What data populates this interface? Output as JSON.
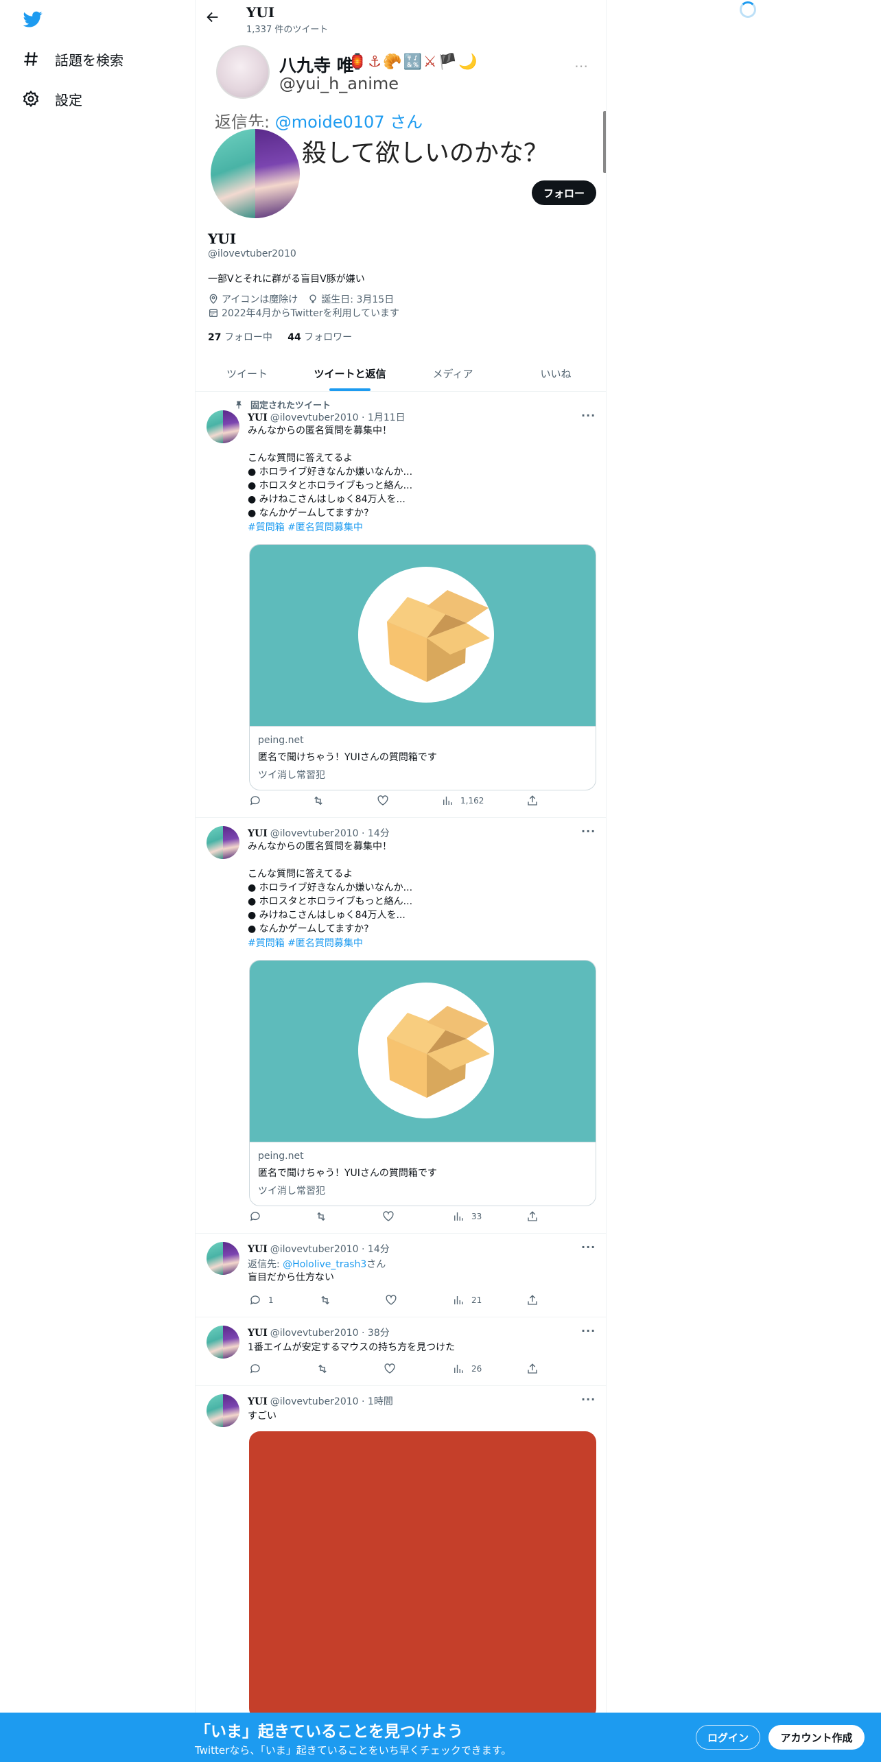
{
  "nav": {
    "explore_label": "話題を検索",
    "settings_label": "設定"
  },
  "header": {
    "name": "YUI",
    "tweet_count": "1,337 件のツイート"
  },
  "banner": {
    "name": "八九寺 唯",
    "emoji": "🏮⚓🥐🔣⚔🏴🌙",
    "handle": "@yui_h_anime",
    "more": "⋯",
    "reply_prefix": "返信先:",
    "reply_link": "@moide0107",
    "reply_suffix": "さん",
    "text": "殺して欲しいのかな？"
  },
  "profile": {
    "follow_label": "フォロー",
    "name": "YUI",
    "handle": "@ilovevtuber2010",
    "bio": "一部Vとそれに群がる盲目V豚が嫌い",
    "location": "アイコンは魔除け",
    "birthday": "誕生日: 3月15日",
    "joined": "2022年4月からTwitterを利用しています",
    "following_count": "27",
    "following_label": "フォロー中",
    "followers_count": "44",
    "followers_label": "フォロワー"
  },
  "tabs": [
    {
      "label": "ツイート",
      "active": false
    },
    {
      "label": "ツイートと返信",
      "active": true
    },
    {
      "label": "メディア",
      "active": false
    },
    {
      "label": "いいね",
      "active": false
    }
  ],
  "tweets": [
    {
      "pinned_label": "固定されたツイート",
      "name": "YUI",
      "handle": "@ilovevtuber2010",
      "time": "1月11日",
      "text": "みんなからの匿名質問を募集中！\n\nこんな質問に答えてるよ\n● ホロライブ好きなんか嫌いなんか...\n● ホロスタとホロライブもっと絡ん...\n● みけねこさんはしゅく84万人を...\n● なんかゲームしてますか?",
      "tags": "#質問箱 #匿名質問募集中",
      "card": {
        "domain": "peing.net",
        "title": "匿名で聞けちゃう！YUIさんの質問箱です",
        "desc": "ツイ消し常習犯"
      },
      "replies": "",
      "views": "1,162"
    },
    {
      "name": "YUI",
      "handle": "@ilovevtuber2010",
      "time": "14分",
      "text": "みんなからの匿名質問を募集中！\n\nこんな質問に答えてるよ\n● ホロライブ好きなんか嫌いなんか...\n● ホロスタとホロライブもっと絡ん...\n● みけねこさんはしゅく84万人を...\n● なんかゲームしてますか?",
      "tags": "#質問箱 #匿名質問募集中",
      "card": {
        "domain": "peing.net",
        "title": "匿名で聞けちゃう！YUIさんの質問箱です",
        "desc": "ツイ消し常習犯"
      },
      "replies": "",
      "views": "33"
    },
    {
      "name": "YUI",
      "handle": "@ilovevtuber2010",
      "time": "14分",
      "reply_prefix": "返信先:",
      "reply_link": "@Hololive_trash3",
      "reply_suffix": "さん",
      "text": "盲目だから仕方ない",
      "replies": "1",
      "views": "21"
    },
    {
      "name": "YUI",
      "handle": "@ilovevtuber2010",
      "time": "38分",
      "text": "1番エイムが安定するマウスの持ち方を見つけた",
      "replies": "",
      "views": "26"
    },
    {
      "name": "YUI",
      "handle": "@ilovevtuber2010",
      "time": "1時間",
      "text": "すごい"
    }
  ],
  "separator": "·",
  "more_glyph": "···",
  "bottom": {
    "title": "「いま」起きていることを見つけよう",
    "subtitle": "Twitterなら、「いま」起きていることをいち早くチェックできます。",
    "login_label": "ログイン",
    "signup_label": "アカウント作成"
  },
  "colors": {
    "accent": "#1d9bf0",
    "card_bg": "#5ebbbb",
    "photo_bg": "#c53f2a"
  }
}
